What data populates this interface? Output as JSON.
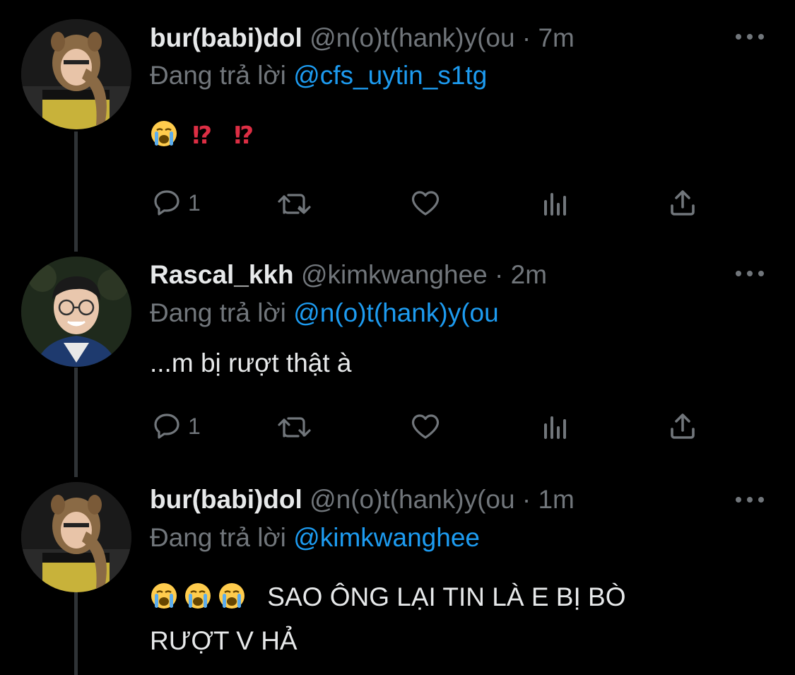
{
  "reply_prefix": "Đang trả lời",
  "colors": {
    "background": "#000000",
    "secondary_text": "#71767b",
    "link": "#1d9bf0",
    "thread_line": "#2f3336"
  },
  "tweets": [
    {
      "display_name": "bur(babi)dol",
      "handle": "@n(o)t(hank)y(ou",
      "separator": "·",
      "time": "7m",
      "reply_to": "@cfs_uytin_s1tg",
      "emojis": [
        "loudly-crying-face",
        "interrobang",
        "interrobang"
      ],
      "text": "",
      "actions": {
        "reply_count": "1",
        "retweet_count": "",
        "like_count": ""
      }
    },
    {
      "display_name": "Rascal_kkh",
      "handle": "@kimkwanghee",
      "separator": "·",
      "time": "2m",
      "reply_to": "@n(o)t(hank)y(ou",
      "text": "...m bị rượt thật à",
      "actions": {
        "reply_count": "1",
        "retweet_count": "",
        "like_count": ""
      }
    },
    {
      "display_name": "bur(babi)dol",
      "handle": "@n(o)t(hank)y(ou",
      "separator": "·",
      "time": "1m",
      "reply_to": "@kimkwanghee",
      "emojis": [
        "loudly-crying-face",
        "loudly-crying-face",
        "loudly-crying-face"
      ],
      "text_line1": "SAO ÔNG LẠI TIN LÀ E BỊ BÒ",
      "text_line2": "RƯỢT V HẢ"
    }
  ],
  "icons": [
    "reply-icon",
    "retweet-icon",
    "like-icon",
    "analytics-icon",
    "share-icon",
    "more-icon"
  ]
}
